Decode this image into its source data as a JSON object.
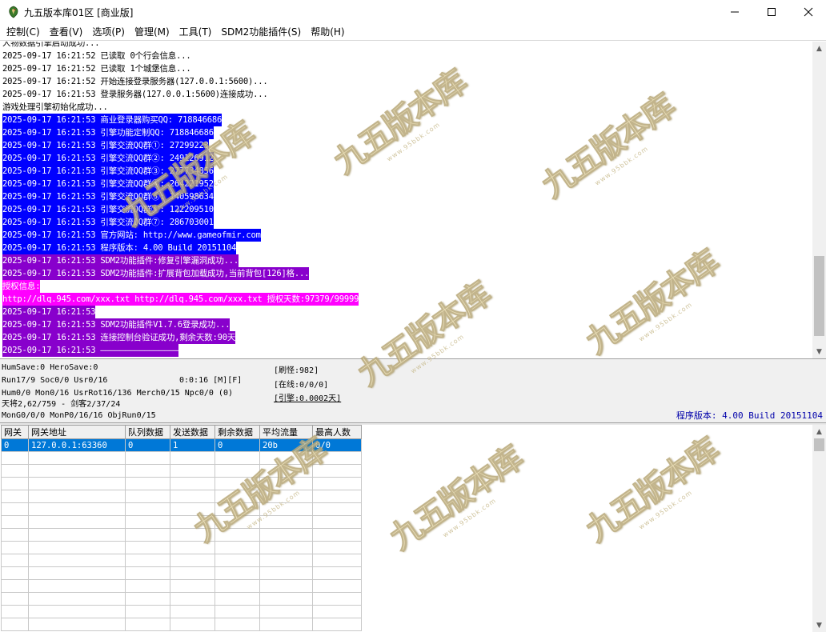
{
  "window": {
    "title": "九五版本库01区 [商业版]",
    "app_icon": "dragon-app-icon",
    "controls": {
      "minimize": "—",
      "maximize": "☐",
      "close": "✕"
    }
  },
  "menu": [
    "控制(C)",
    "查看(V)",
    "选项(P)",
    "管理(M)",
    "工具(T)",
    "SDM2功能插件(S)",
    "帮助(H)"
  ],
  "log": {
    "lines": [
      {
        "text": "人物数据引擎启动成功...",
        "fg": "#000000",
        "bg": ""
      },
      {
        "text": "2025-09-17 16:21:52 已读取 0个行会信息...",
        "fg": "#000000",
        "bg": ""
      },
      {
        "text": "2025-09-17 16:21:52 已读取 1个城堡信息...",
        "fg": "#000000",
        "bg": ""
      },
      {
        "text": "2025-09-17 16:21:52 开始连接登录服务器(127.0.0.1:5600)...",
        "fg": "#000000",
        "bg": ""
      },
      {
        "text": "2025-09-17 16:21:53 登录服务器(127.0.0.1:5600)连接成功...",
        "fg": "#000000",
        "bg": ""
      },
      {
        "text": "游戏处理引擎初始化成功...",
        "fg": "#000000",
        "bg": ""
      },
      {
        "text": "2025-09-17 16:21:53 商业登录器购买QQ: 718846686",
        "fg": "#ffffff",
        "bg": "#0000ff"
      },
      {
        "text": "2025-09-17 16:21:53 引擎功能定制QQ: 718846686",
        "fg": "#ffffff",
        "bg": "#0000ff"
      },
      {
        "text": "2025-09-17 16:21:53 引擎交流QQ群①: 27299223",
        "fg": "#ffffff",
        "bg": "#0000ff"
      },
      {
        "text": "2025-09-17 16:21:53 引擎交流QQ群②: 249126912",
        "fg": "#ffffff",
        "bg": "#0000ff"
      },
      {
        "text": "2025-09-17 16:21:53 引擎交流QQ群③: 277734856",
        "fg": "#ffffff",
        "bg": "#0000ff"
      },
      {
        "text": "2025-09-17 16:21:53 引擎交流QQ群④: 264221952",
        "fg": "#ffffff",
        "bg": "#0000ff"
      },
      {
        "text": "2025-09-17 16:21:53 引擎交流QQ群⑤: 140598634",
        "fg": "#ffffff",
        "bg": "#0000ff"
      },
      {
        "text": "2025-09-17 16:21:53 引擎交流QQ群⑥: 122209510",
        "fg": "#ffffff",
        "bg": "#0000ff"
      },
      {
        "text": "2025-09-17 16:21:53 引擎交流QQ群⑦: 286703001",
        "fg": "#ffffff",
        "bg": "#0000ff"
      },
      {
        "text": "2025-09-17 16:21:53 官方网站: http://www.gameofmir.com",
        "fg": "#ffffff",
        "bg": "#0000ff"
      },
      {
        "text": "2025-09-17 16:21:53 程序版本: 4.00 Build 20151104",
        "fg": "#ffffff",
        "bg": "#0000ff"
      },
      {
        "text": "2025-09-17 16:21:53 SDM2功能插件:修复引擎漏洞成功...",
        "fg": "#ffffff",
        "bg": "#8800cc"
      },
      {
        "text": "2025-09-17 16:21:53 SDM2功能插件:扩展背包加载成功,当前背包[126]格...",
        "fg": "#ffffff",
        "bg": "#8800cc"
      },
      {
        "text": "授权信息:",
        "fg": "#ffffff",
        "bg": "#ff00ff"
      },
      {
        "text": "http://dlq.945.com/xxx.txt http://dlq.945.com/xxx.txt 授权天数:97379/99999",
        "fg": "#ffffff",
        "bg": "#ff00ff"
      },
      {
        "text": "2025-09-17 16:21:53",
        "fg": "#ffffff",
        "bg": "#8800cc"
      },
      {
        "text": "2025-09-17 16:21:53 SDM2功能插件V1.7.6登录成功...",
        "fg": "#ffffff",
        "bg": "#8800cc"
      },
      {
        "text": "2025-09-17 16:21:53 连接控制台验证成功,剩余天数:90天",
        "fg": "#ffffff",
        "bg": "#8800cc"
      },
      {
        "text": "2025-09-17 16:21:53 ————————————————",
        "fg": "#ffffff",
        "bg": "#8800cc"
      }
    ]
  },
  "status": {
    "line1": "HumSave:0 HeroSave:0",
    "line2": "Run17/9 Soc0/0 Usr0/16",
    "timer": "0:0:16 [M][F]",
    "line3": "Hum0/0 Mon0/16 UsrRot16/136 Merch0/15 Npc0/0 (0)",
    "line4": "天将2,62/759 - 剑客2/37/24",
    "line5": "MonG0/0/0 MonP0/16/16 ObjRun0/15",
    "refresh": "[刷怪:982]",
    "online": "[在线:0/0/0]",
    "engine": "[引擎:0.0002天]",
    "version": "程序版本: 4.00 Build 20151104"
  },
  "gateway_table": {
    "columns": [
      "网关",
      "网关地址",
      "队列数据",
      "发送数据",
      "剩余数据",
      "平均流量",
      "最高人数"
    ],
    "rows": [
      [
        "0",
        "127.0.0.1:63360",
        "0",
        "1",
        "0",
        "20b",
        "0/0"
      ]
    ]
  },
  "watermark": {
    "text": "九五版本库",
    "subtext": "www.95bbk.com"
  }
}
